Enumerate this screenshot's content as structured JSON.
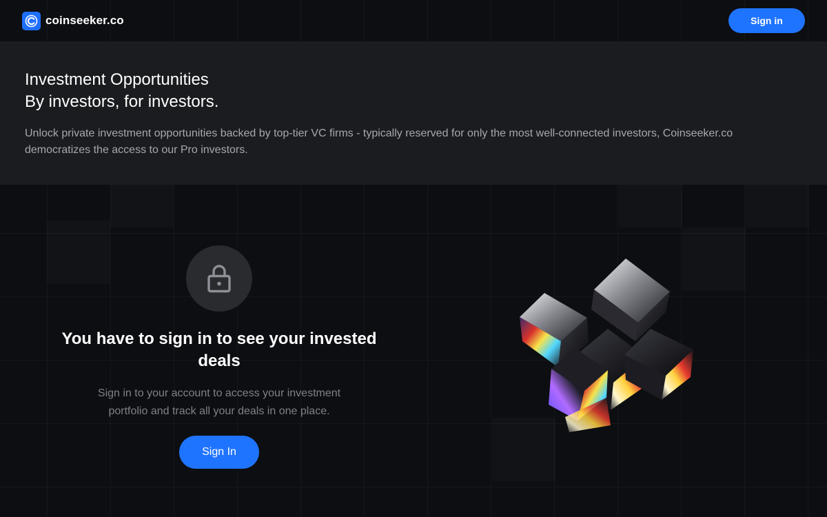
{
  "header": {
    "logo_text": "coinseeker.co",
    "signin_label": "Sign in"
  },
  "hero": {
    "title_line1": "Investment Opportunities",
    "title_line2": "By investors, for investors.",
    "description": "Unlock private investment opportunities backed by top-tier VC firms - typically reserved for only the most well-connected investors, Coinseeker.co democratizes the access to our Pro investors."
  },
  "locked": {
    "icon": "lock-icon",
    "heading": "You have to sign in to see your invested deals",
    "subtext": "Sign in to your account to access your investment portfolio and track all your deals in one place.",
    "button_label": "Sign In"
  },
  "colors": {
    "accent": "#1f74ff",
    "page_bg": "#0d0e11",
    "hero_bg": "#1b1c1f"
  }
}
